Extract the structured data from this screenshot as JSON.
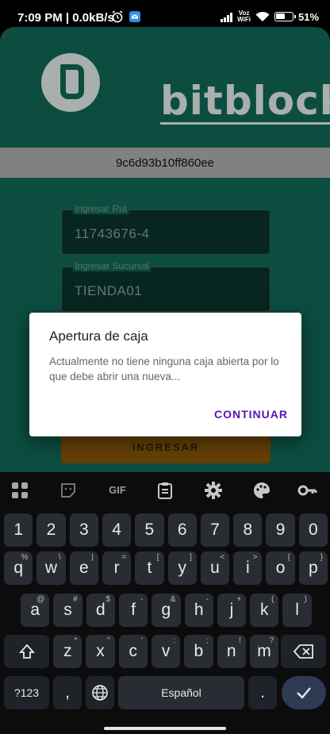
{
  "status_bar": {
    "time": "7:09 PM",
    "speed": "0.0kB/s",
    "volte": "Voz\nWiFi",
    "battery_percent": "51"
  },
  "app": {
    "brand": "bitblock",
    "device_id": "9c6d93b10ff860ee",
    "rut_field": {
      "label": "Ingresar Rut",
      "value": "11743676-4"
    },
    "sucursal_field": {
      "label": "Ingresar Sucursal",
      "value": "TIENDA01"
    },
    "ingresar_label": "INGRESAR"
  },
  "dialog": {
    "title": "Apertura de caja",
    "message": "Actualmente no tiene ninguna caja abierta por lo que debe abrir una nueva...",
    "button": "CONTINUAR"
  },
  "keyboard": {
    "toolbar": [
      "apps-icon",
      "sticker-icon",
      "GIF",
      "clipboard-icon",
      "gear-icon",
      "palette-icon",
      "key-icon"
    ],
    "row_numbers": [
      "1",
      "2",
      "3",
      "4",
      "5",
      "6",
      "7",
      "8",
      "9",
      "0"
    ],
    "row1": [
      {
        "k": "q",
        "s": "%"
      },
      {
        "k": "w",
        "s": "\\"
      },
      {
        "k": "e",
        "s": "|"
      },
      {
        "k": "r",
        "s": "="
      },
      {
        "k": "t",
        "s": "["
      },
      {
        "k": "y",
        "s": "]"
      },
      {
        "k": "u",
        "s": "<"
      },
      {
        "k": "i",
        "s": ">"
      },
      {
        "k": "o",
        "s": "{"
      },
      {
        "k": "p",
        "s": "}"
      }
    ],
    "row2": [
      {
        "k": "a",
        "s": "@"
      },
      {
        "k": "s",
        "s": "#"
      },
      {
        "k": "d",
        "s": "$"
      },
      {
        "k": "f",
        "s": "-"
      },
      {
        "k": "g",
        "s": "&"
      },
      {
        "k": "h",
        "s": "-"
      },
      {
        "k": "j",
        "s": "+"
      },
      {
        "k": "k",
        "s": "("
      },
      {
        "k": "l",
        "s": ")"
      }
    ],
    "row3": [
      {
        "k": "z",
        "s": "*"
      },
      {
        "k": "x",
        "s": "\""
      },
      {
        "k": "c",
        "s": "'"
      },
      {
        "k": "v",
        "s": ":"
      },
      {
        "k": "b",
        "s": ";"
      },
      {
        "k": "n",
        "s": "!"
      },
      {
        "k": "m",
        "s": "?"
      }
    ],
    "symbols_label": "?123",
    "comma": ",",
    "space_label": "Español",
    "period": "."
  }
}
